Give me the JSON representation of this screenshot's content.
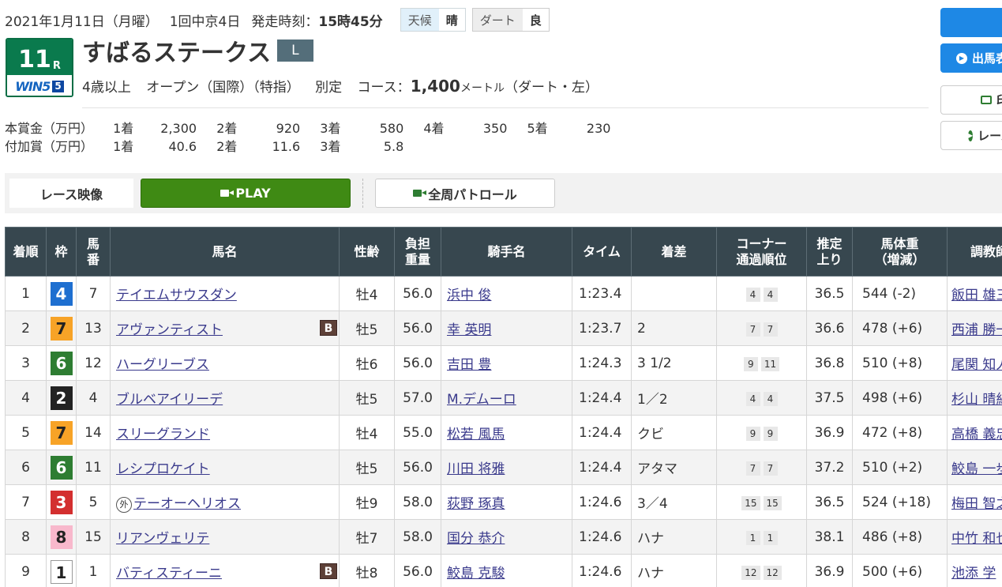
{
  "race_info": {
    "date": "2021年1月11日（月曜）",
    "meeting": "1回中京4日",
    "start_label": "発走時刻：",
    "start_time": "15時45分",
    "weather_label": "天候",
    "weather": "晴",
    "track_label": "ダート",
    "track_condition": "良"
  },
  "race_number": {
    "num": "11",
    "unit": "R",
    "win5_label": "WIN5",
    "win5_num": "5"
  },
  "race_name": "すばるステークス",
  "grade": "L",
  "conditions": {
    "age": "4歳以上",
    "class": "オープン（国際）（特指）",
    "weight_rule": "別定",
    "course_label": "コース：",
    "distance": "1,400",
    "unit": "メートル",
    "surface": "（ダート・左）"
  },
  "prizes": {
    "main_label": "本賞金（万円）",
    "main": [
      {
        "pos": "1着",
        "val": "2,300"
      },
      {
        "pos": "2着",
        "val": "920"
      },
      {
        "pos": "3着",
        "val": "580"
      },
      {
        "pos": "4着",
        "val": "350"
      },
      {
        "pos": "5着",
        "val": "230"
      }
    ],
    "extra_label": "付加賞（万円）",
    "extra": [
      {
        "pos": "1着",
        "val": "40.6"
      },
      {
        "pos": "2着",
        "val": "11.6"
      },
      {
        "pos": "3着",
        "val": "5.8"
      }
    ]
  },
  "video": {
    "label": "レース映像",
    "play": "PLAY",
    "patrol": "全周パトロール"
  },
  "side_buttons": {
    "b2": "出馬表",
    "b3": "印",
    "b4": "レース"
  },
  "colors": {
    "waku1": "#ffffff",
    "waku2": "#222222",
    "waku3": "#d32f2f",
    "waku4": "#1e6fd0",
    "waku6": "#2e7d32",
    "waku7": "#f7a327",
    "waku8": "#f8b8cc"
  },
  "table": {
    "headers": {
      "rank": "着順",
      "waku": "枠",
      "umaban_1": "馬",
      "umaban_2": "番",
      "horse": "馬名",
      "sexage": "性齢",
      "weight_1": "負担",
      "weight_2": "重量",
      "jockey": "騎手名",
      "time": "タイム",
      "margin": "着差",
      "corner_1": "コーナー",
      "corner_2": "通過順位",
      "last3f_1": "推定",
      "last3f_2": "上り",
      "body_1": "馬体重",
      "body_2": "（増減）",
      "trainer": "調教師"
    },
    "rows": [
      {
        "rank": "1",
        "waku": "4",
        "umaban": "7",
        "horse": "テイエムサウスダン",
        "sexage": "牡4",
        "weight": "56.0",
        "jockey": "浜中 俊",
        "time": "1:23.4",
        "margin": "",
        "c1": "4",
        "c2": "4",
        "last3f": "36.5",
        "body": "544 (-2)",
        "trainer": "飯田 雄三"
      },
      {
        "rank": "2",
        "waku": "7",
        "umaban": "13",
        "horse": "アヴァンティスト",
        "blinker": "B",
        "sexage": "牡5",
        "weight": "56.0",
        "jockey": "幸 英明",
        "time": "1:23.7",
        "margin": "2",
        "c1": "7",
        "c2": "7",
        "last3f": "36.6",
        "body": "478 (+6)",
        "trainer": "西浦 勝一"
      },
      {
        "rank": "3",
        "waku": "6",
        "umaban": "12",
        "horse": "ハーグリーブス",
        "sexage": "牡6",
        "weight": "56.0",
        "jockey": "吉田 豊",
        "time": "1:24.3",
        "margin": "3 1/2",
        "c1": "9",
        "c2": "11",
        "last3f": "36.8",
        "body": "510 (+8)",
        "trainer": "尾関 知人"
      },
      {
        "rank": "4",
        "waku": "2",
        "umaban": "4",
        "horse": "ブルベアイリーデ",
        "sexage": "牡5",
        "weight": "57.0",
        "jockey": "M.デムーロ",
        "time": "1:24.4",
        "margin": "1／2",
        "c1": "4",
        "c2": "4",
        "last3f": "37.5",
        "body": "498 (+6)",
        "trainer": "杉山 晴紀"
      },
      {
        "rank": "5",
        "waku": "7",
        "umaban": "14",
        "horse": "スリーグランド",
        "sexage": "牡4",
        "weight": "55.0",
        "jockey": "松若 風馬",
        "time": "1:24.4",
        "margin": "クビ",
        "c1": "9",
        "c2": "9",
        "last3f": "36.9",
        "body": "472 (+8)",
        "trainer": "高橋 義忠"
      },
      {
        "rank": "6",
        "waku": "6",
        "umaban": "11",
        "horse": "レシプロケイト",
        "sexage": "牡5",
        "weight": "56.0",
        "jockey": "川田 将雅",
        "time": "1:24.4",
        "margin": "アタマ",
        "c1": "7",
        "c2": "7",
        "last3f": "37.2",
        "body": "510 (+2)",
        "trainer": "鮫島 一歩"
      },
      {
        "rank": "7",
        "waku": "3",
        "umaban": "5",
        "horse": "テーオーヘリオス",
        "gai": "外",
        "sexage": "牡9",
        "weight": "58.0",
        "jockey": "荻野 琢真",
        "time": "1:24.6",
        "margin": "3／4",
        "c1": "15",
        "c2": "15",
        "last3f": "36.5",
        "body": "524 (+18)",
        "trainer": "梅田 智之"
      },
      {
        "rank": "8",
        "waku": "8",
        "umaban": "15",
        "horse": "リアンヴェリテ",
        "sexage": "牡7",
        "weight": "58.0",
        "jockey": "国分 恭介",
        "time": "1:24.6",
        "margin": "ハナ",
        "c1": "1",
        "c2": "1",
        "last3f": "38.1",
        "body": "486 (+8)",
        "trainer": "中竹 和也"
      },
      {
        "rank": "9",
        "waku": "1",
        "umaban": "1",
        "horse": "バティスティーニ",
        "blinker": "B",
        "sexage": "牡8",
        "weight": "56.0",
        "jockey": "鮫島 克駿",
        "time": "1:24.6",
        "margin": "ハナ",
        "c1": "12",
        "c2": "12",
        "last3f": "36.9",
        "body": "500 (+6)",
        "trainer": "池添 学"
      }
    ]
  }
}
